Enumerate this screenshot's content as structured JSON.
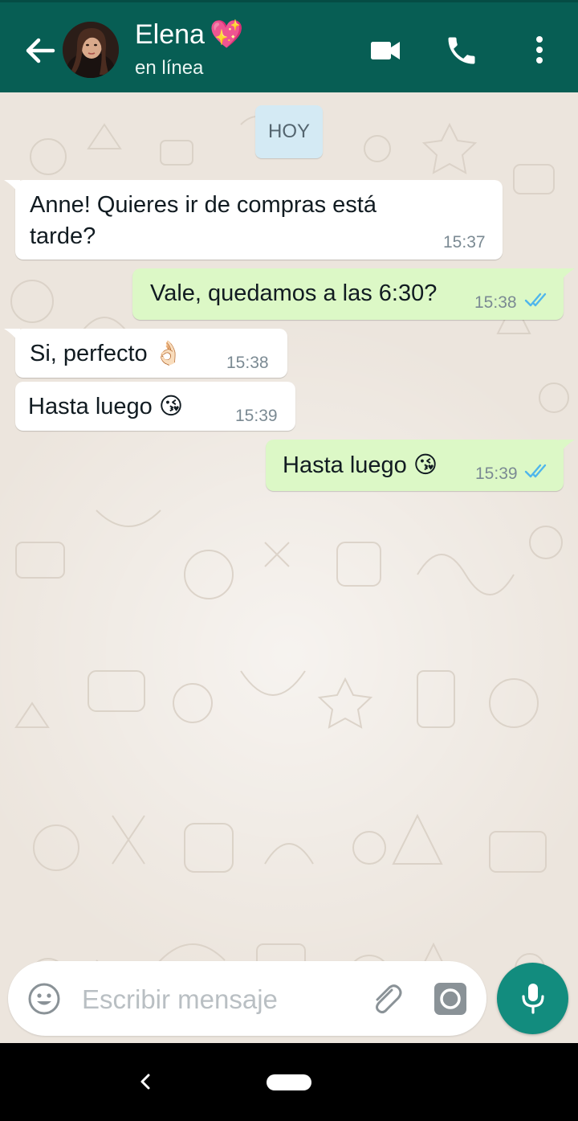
{
  "header": {
    "contact_name": "Elena",
    "contact_emoji": "💖",
    "status": "en línea",
    "back_icon": "arrow-left-icon",
    "actions": [
      "video-call-icon",
      "phone-icon",
      "more-vert-icon"
    ],
    "background_color": "#075e54"
  },
  "chat": {
    "date_label": "HOY",
    "messages": [
      {
        "direction": "in",
        "text": "Anne! Quieres ir de compras está\ntarde?",
        "time": "15:37"
      },
      {
        "direction": "out",
        "text": "Vale, quedamos a las 6:30?",
        "time": "15:38",
        "status": "read"
      },
      {
        "direction": "in",
        "text": "Si, perfecto",
        "emoji": "👌🏻",
        "time": "15:38"
      },
      {
        "direction": "in",
        "text": "Hasta luego",
        "emoji": "😘",
        "time": "15:39"
      },
      {
        "direction": "out",
        "text": "Hasta luego",
        "emoji": "😘",
        "time": "15:39",
        "status": "read"
      }
    ],
    "colors": {
      "incoming": "#ffffff",
      "outgoing": "#dcf8c6",
      "read_ticks": "#4fb6ec"
    }
  },
  "composer": {
    "placeholder": "Escribir mensaje",
    "value": "",
    "icons": [
      "emoji-icon",
      "paperclip-icon",
      "camera-icon",
      "mic-icon"
    ],
    "mic_color": "#128c7e"
  },
  "system_nav": {
    "icons": [
      "nav-back-icon",
      "nav-home-pill"
    ]
  }
}
